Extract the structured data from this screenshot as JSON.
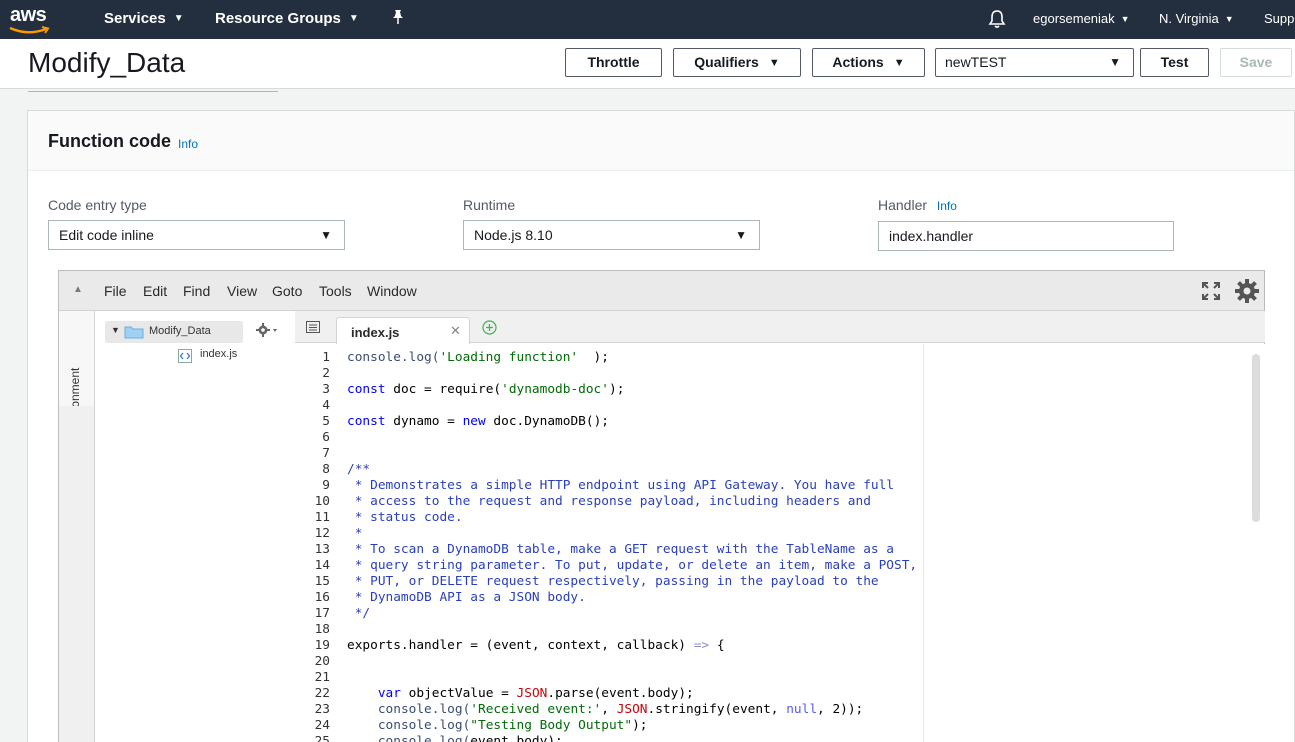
{
  "nav": {
    "logo_text": "aws",
    "services_label": "Services",
    "resource_groups_label": "Resource Groups",
    "user_label": "egorsemeniak",
    "region_label": "N. Virginia",
    "support_label": "Supp"
  },
  "header": {
    "title": "Modify_Data",
    "throttle_label": "Throttle",
    "qualifiers_label": "Qualifiers",
    "actions_label": "Actions",
    "test_event_value": "newTEST",
    "test_label": "Test",
    "save_label": "Save"
  },
  "panel": {
    "title": "Function code",
    "info_label": "Info",
    "code_entry_label": "Code entry type",
    "code_entry_value": "Edit code inline",
    "runtime_label": "Runtime",
    "runtime_value": "Node.js 8.10",
    "handler_label": "Handler",
    "handler_info_label": "Info",
    "handler_value": "index.handler"
  },
  "ide": {
    "menu": [
      "File",
      "Edit",
      "Find",
      "View",
      "Goto",
      "Tools",
      "Window"
    ],
    "environment_label": "Environment",
    "folder_name": "Modify_Data",
    "file_name": "index.js",
    "active_tab": "index.js",
    "code_lines": [
      {
        "n": "1",
        "parts": [
          [
            "c-fn",
            "console.log("
          ],
          [
            "c-str",
            "'Loading function'"
          ],
          [
            "",
            "  );"
          ]
        ]
      },
      {
        "n": "2",
        "parts": []
      },
      {
        "n": "3",
        "parts": [
          [
            "c-kw",
            "const"
          ],
          [
            "",
            " doc = require("
          ],
          [
            "c-str",
            "'dynamodb-doc'"
          ],
          [
            "",
            ");"
          ]
        ]
      },
      {
        "n": "4",
        "parts": []
      },
      {
        "n": "5",
        "parts": [
          [
            "c-kw",
            "const"
          ],
          [
            "",
            " dynamo = "
          ],
          [
            "c-kw",
            "new"
          ],
          [
            "",
            " doc.DynamoDB();"
          ]
        ]
      },
      {
        "n": "6",
        "parts": []
      },
      {
        "n": "7",
        "parts": []
      },
      {
        "n": "8",
        "parts": [
          [
            "c-com",
            "/**"
          ]
        ]
      },
      {
        "n": "9",
        "parts": [
          [
            "c-com",
            " * Demonstrates a simple HTTP endpoint using API Gateway. You have full"
          ]
        ]
      },
      {
        "n": "10",
        "parts": [
          [
            "c-com",
            " * access to the request and response payload, including headers and"
          ]
        ]
      },
      {
        "n": "11",
        "parts": [
          [
            "c-com",
            " * status code."
          ]
        ]
      },
      {
        "n": "12",
        "parts": [
          [
            "c-com",
            " *"
          ]
        ]
      },
      {
        "n": "13",
        "parts": [
          [
            "c-com",
            " * To scan a DynamoDB table, make a GET request with the TableName as a"
          ]
        ]
      },
      {
        "n": "14",
        "parts": [
          [
            "c-com",
            " * query string parameter. To put, update, or delete an item, make a POST,"
          ]
        ]
      },
      {
        "n": "15",
        "parts": [
          [
            "c-com",
            " * PUT, or DELETE request respectively, passing in the payload to the"
          ]
        ]
      },
      {
        "n": "16",
        "parts": [
          [
            "c-com",
            " * DynamoDB API as a JSON body."
          ]
        ]
      },
      {
        "n": "17",
        "parts": [
          [
            "c-com",
            " */"
          ]
        ]
      },
      {
        "n": "18",
        "parts": []
      },
      {
        "n": "19",
        "parts": [
          [
            "",
            "exports.handler = (event, context, callback) "
          ],
          [
            "c-ar",
            "=>"
          ],
          [
            "",
            " {"
          ]
        ]
      },
      {
        "n": "20",
        "parts": []
      },
      {
        "n": "21",
        "parts": []
      },
      {
        "n": "22",
        "parts": [
          [
            "",
            "    "
          ],
          [
            "c-kw",
            "var"
          ],
          [
            "",
            " objectValue = "
          ],
          [
            "c-json",
            "JSON"
          ],
          [
            "",
            ".parse(event.body);"
          ]
        ]
      },
      {
        "n": "23",
        "parts": [
          [
            "",
            "    "
          ],
          [
            "c-fn",
            "console.log("
          ],
          [
            "c-str",
            "'Received event:'"
          ],
          [
            "",
            ", "
          ],
          [
            "c-json",
            "JSON"
          ],
          [
            "",
            ".stringify(event, "
          ],
          [
            "c-null",
            "null"
          ],
          [
            "",
            ", 2));"
          ]
        ]
      },
      {
        "n": "24",
        "parts": [
          [
            "",
            "    "
          ],
          [
            "c-fn",
            "console.log("
          ],
          [
            "c-str",
            "\"Testing Body Output\""
          ],
          [
            "",
            ");"
          ]
        ]
      },
      {
        "n": "25",
        "parts": [
          [
            "",
            "    "
          ],
          [
            "c-fn",
            "console.log("
          ],
          [
            "",
            "event.body);"
          ]
        ]
      }
    ]
  },
  "colors": {
    "nav_bg": "#232f3e",
    "link": "#0073bb",
    "string": "#036a07",
    "keyword": "#0000ff",
    "comment": "#2a3fbd"
  }
}
